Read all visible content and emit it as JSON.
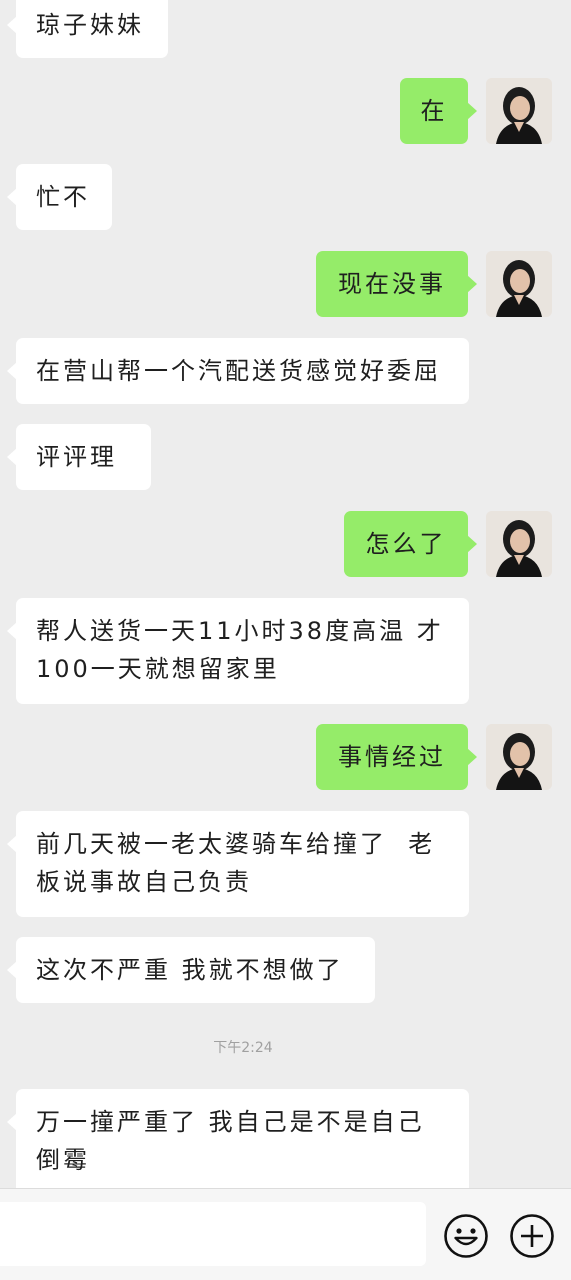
{
  "messages": [
    {
      "side": "in",
      "text": "琼子妹妹"
    },
    {
      "side": "out",
      "text": "在"
    },
    {
      "side": "in",
      "text": "忙不"
    },
    {
      "side": "out",
      "text": "现在没事"
    },
    {
      "side": "in",
      "text": "在营山帮一个汽配送货感觉好委屈"
    },
    {
      "side": "in",
      "text": "评评理"
    },
    {
      "side": "out",
      "text": "怎么了"
    },
    {
      "side": "in",
      "text": "帮人送货一天11小时38度高温 才\n100一天就想留家里"
    },
    {
      "side": "out",
      "text": "事情经过"
    },
    {
      "side": "in",
      "text": "前几天被一老太婆骑车给撞了  老\n板说事故自己负责"
    },
    {
      "side": "in",
      "text": "这次不严重 我就不想做了"
    },
    {
      "side": "in",
      "text": "万一撞严重了 我自己是不是自己\n倒霉"
    }
  ],
  "timestamp": "下午2:24",
  "input": {
    "value": "",
    "placeholder": ""
  },
  "icons": {
    "emoji": "smiley-face-icon",
    "plus": "plus-circle-icon"
  },
  "colors": {
    "background": "#ededed",
    "incoming_bubble": "#ffffff",
    "outgoing_bubble": "#95ec69",
    "toolbar": "#f6f6f6"
  }
}
